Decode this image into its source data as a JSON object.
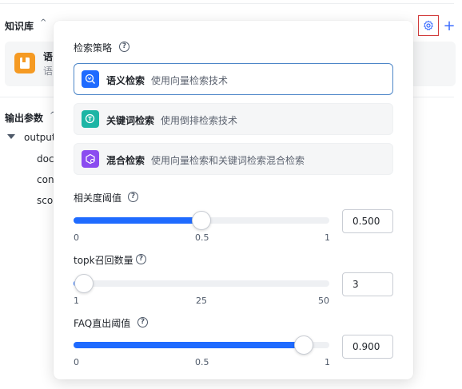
{
  "background": {
    "kb_title": "知识库",
    "kb_card": {
      "line1": "语",
      "line2": "语"
    },
    "output_title": "输出参数",
    "tree_root": "output_",
    "tree_children": [
      "docu",
      "cont",
      "scor"
    ]
  },
  "popover": {
    "strategy_label": "检索策略",
    "options": [
      {
        "name": "语义检索",
        "desc": "使用向量检索技术",
        "selected": true,
        "icon": "semantic-search-icon",
        "color": "#1f6bff"
      },
      {
        "name": "关键词检索",
        "desc": "使用倒排检索技术",
        "selected": false,
        "icon": "keyword-search-icon",
        "color": "#1db5a5"
      },
      {
        "name": "混合检索",
        "desc": "使用向量检索和关键词检索混合检索",
        "selected": false,
        "icon": "hybrid-search-icon",
        "color": "#8b4cf0"
      }
    ],
    "sliders": [
      {
        "label": "相关度阈值",
        "min_label": "0",
        "mid_label": "0.5",
        "max_label": "1",
        "value": "0.500",
        "fraction": 0.5
      },
      {
        "label": "topk召回数量",
        "min_label": "1",
        "mid_label": "25",
        "max_label": "50",
        "value": "3",
        "fraction": 0.04
      },
      {
        "label": "FAQ直出阈值",
        "min_label": "0",
        "mid_label": "0.5",
        "max_label": "1",
        "value": "0.900",
        "fraction": 0.9
      }
    ]
  },
  "colors": {
    "accent": "#1f6bff",
    "highlight_border": "#d23c3c"
  }
}
